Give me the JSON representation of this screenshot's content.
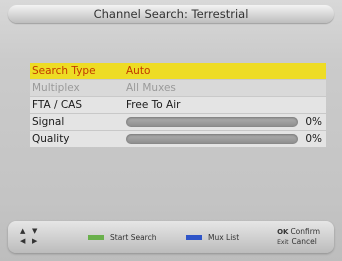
{
  "window": {
    "title": "Channel Search: Terrestrial"
  },
  "menu": {
    "rows": [
      {
        "label": "Search Type",
        "value": "Auto",
        "state": "selected"
      },
      {
        "label": "Multiplex",
        "value": "All Muxes",
        "state": "disabled"
      },
      {
        "label": "FTA / CAS",
        "value": "Free To Air",
        "state": "normal"
      }
    ],
    "signal": {
      "label": "Signal",
      "percent_text": "0%",
      "level": 0
    },
    "quality": {
      "label": "Quality",
      "percent_text": "0%",
      "level": 0
    }
  },
  "footer": {
    "nav": {
      "up": "▲",
      "down": "▼",
      "left": "◀",
      "right": "▶"
    },
    "green_hint": {
      "label": "Start Search",
      "color": "#6ab04c"
    },
    "blue_hint": {
      "label": "Mux List",
      "color": "#2f55c8"
    },
    "ok_key": "OK",
    "ok_label": "Confirm",
    "exit_key": "Exit",
    "exit_label": "Cancel"
  },
  "colors": {
    "highlight": "#eedc24",
    "highlight_text": "#c03a00"
  }
}
